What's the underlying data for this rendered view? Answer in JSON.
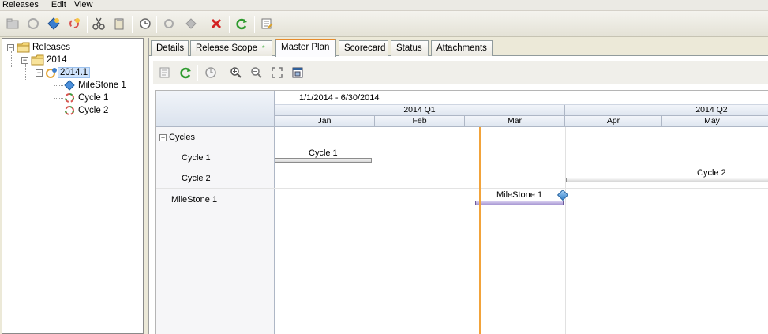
{
  "menu": [
    "Releases",
    "Edit",
    "View"
  ],
  "tree": {
    "root": "Releases",
    "folder": "2014",
    "release": "2014.1",
    "children": [
      "MileStone 1",
      "Cycle 1",
      "Cycle 2"
    ]
  },
  "tabs": [
    {
      "label": "Details"
    },
    {
      "label": "Release Scope",
      "modified_mark": "*"
    },
    {
      "label": "Master Plan"
    },
    {
      "label": "Scorecard"
    },
    {
      "label": "Status"
    },
    {
      "label": "Attachments"
    }
  ],
  "active_tab": "Master Plan",
  "gantt": {
    "date_range": "1/1/2014 - 6/30/2014",
    "quarters": [
      "2014 Q1",
      "2014 Q2"
    ],
    "months": [
      "Jan",
      "Feb",
      "Mar",
      "Apr",
      "May"
    ],
    "group_label": "Cycles",
    "rows": [
      "Cycle 1",
      "Cycle 2",
      "MileStone 1"
    ],
    "bars": {
      "cycle1": "Cycle 1",
      "cycle2": "Cycle 2",
      "milestone": "MileStone 1"
    }
  },
  "colors": {
    "today_line": "#f2a33a",
    "milestone_bar": "#a796d2",
    "active_tab_accent": "#e68b2c"
  }
}
